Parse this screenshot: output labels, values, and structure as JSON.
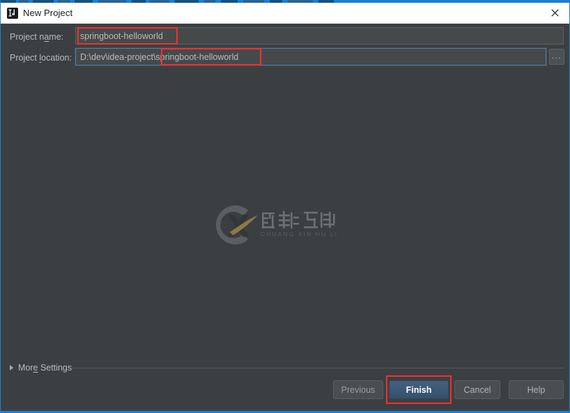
{
  "window": {
    "title": "New Project",
    "app_icon": "intellij-idea-icon",
    "close_icon": "close-icon",
    "accent_color": "#1a7fd4",
    "background_color": "#3c3f41"
  },
  "form": {
    "name_label_pre": "Project n",
    "name_label_mnemonic": "a",
    "name_label_post": "me:",
    "name_value": "springboot-helloworld",
    "name_placeholder": "",
    "location_label_pre": "Project ",
    "location_label_mnemonic": "l",
    "location_label_post": "ocation:",
    "location_value": "D:\\dev\\idea-project\\springboot-helloworld",
    "location_placeholder": "",
    "browse_label": "...",
    "browse_icon": "ellipsis-icon"
  },
  "more_settings": {
    "label_pre": "Mor",
    "label_mnemonic": "e",
    "label_post": " Settings",
    "expander_icon": "chevron-right-icon",
    "expanded": "false"
  },
  "buttons": {
    "previous": "Previous",
    "finish": "Finish",
    "cancel": "Cancel",
    "help": "Help",
    "default_button": "Finish"
  },
  "annotations": {
    "color": "#f1312f",
    "boxes": [
      {
        "name": "project-name-value-highlight",
        "target": "springboot-helloworld"
      },
      {
        "name": "project-location-suffix-highlight",
        "target": "\\springboot-helloworld"
      },
      {
        "name": "finish-button-highlight",
        "target": "Finish"
      }
    ]
  },
  "watermark": {
    "chinese": "创新互联",
    "pinyin": "CHUANG XIN HU LIAN",
    "mark_letters": "CX",
    "swoosh_color": "#8a7a46",
    "ring_color": "#5a5d5f"
  }
}
